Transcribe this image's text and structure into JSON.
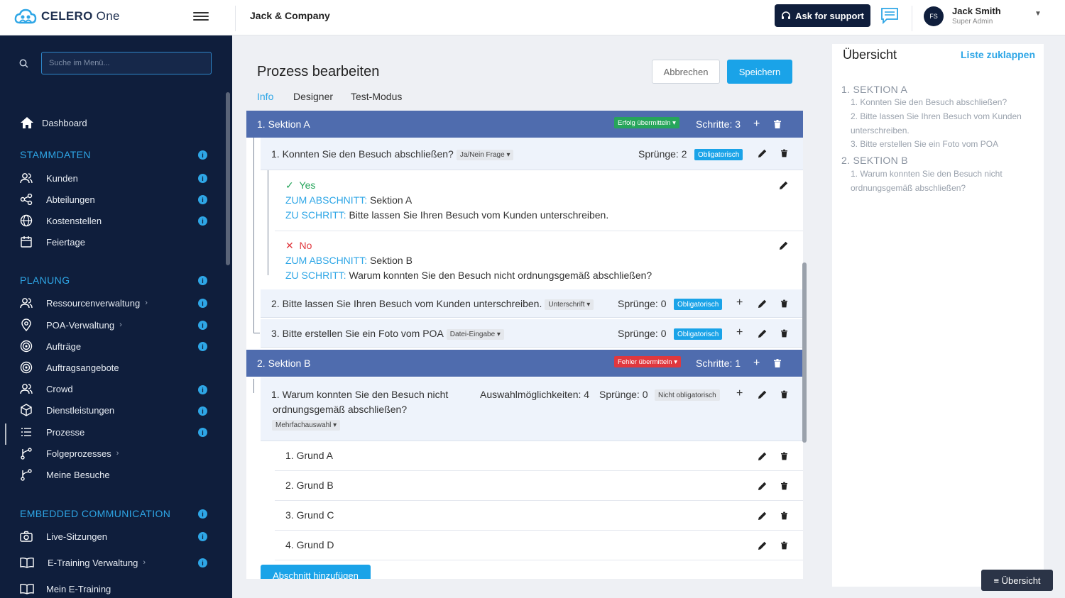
{
  "header": {
    "logo_strong": "CELERO",
    "logo_light": "One",
    "company": "Jack & Company",
    "support_label": "Ask for support",
    "user_initials": "FS",
    "user_name": "Jack Smith",
    "user_role": "Super Admin"
  },
  "sidebar": {
    "search_placeholder": "Suche im Menü...",
    "dashboard": "Dashboard",
    "sections": [
      {
        "title": "STAMMDATEN",
        "items": [
          "Kunden",
          "Abteilungen",
          "Kostenstellen",
          "Feiertage"
        ]
      },
      {
        "title": "PLANUNG",
        "items": [
          "Ressourcenverwaltung",
          "POA-Verwaltung",
          "Aufträge",
          "Auftragsangebote",
          "Crowd",
          "Dienstleistungen",
          "Prozesse",
          "Folgeprozesses",
          "Meine Besuche"
        ]
      },
      {
        "title": "EMBEDDED COMMUNICATION",
        "items": [
          "Live-Sitzungen",
          "E-Training Verwaltung",
          "Mein E-Training"
        ]
      }
    ],
    "active_item": "Prozesse"
  },
  "main": {
    "title": "Prozess bearbeiten",
    "cancel_label": "Abbrechen",
    "save_label": "Speichern",
    "tabs": [
      "Info",
      "Designer",
      "Test-Modus"
    ],
    "active_tab": "Info",
    "add_section_label": "Abschnitt hinzufügen",
    "sections": [
      {
        "title": "1. Sektion A",
        "badge": "Erfolg übermitteln",
        "steps": "Schritte: 3",
        "questions": [
          {
            "text": "1. Konnten Sie den Besuch abschließen?",
            "type": "Ja/Nein Frage",
            "jumps": "Sprünge: 2",
            "required": "Obligatorisch",
            "answers": [
              {
                "label": "Yes",
                "section_key": "ZUM ABSCHNITT:",
                "section_val": "Sektion A",
                "step_key": "ZU SCHRITT:",
                "step_val": "Bitte lassen Sie Ihren Besuch vom Kunden unterschreiben."
              },
              {
                "label": "No",
                "section_key": "ZUM ABSCHNITT:",
                "section_val": "Sektion B",
                "step_key": "ZU SCHRITT:",
                "step_val": "Warum konnten Sie den Besuch nicht  ordnungsgemäß abschließen?"
              }
            ]
          },
          {
            "text": "2. Bitte lassen Sie Ihren Besuch vom Kunden unterschreiben.",
            "type": "Unterschrift",
            "jumps": "Sprünge: 0",
            "required": "Obligatorisch"
          },
          {
            "text": "3. Bitte erstellen Sie ein Foto vom POA",
            "type": "Datei-Eingabe",
            "jumps": "Sprünge: 0",
            "required": "Obligatorisch"
          }
        ]
      },
      {
        "title": "2. Sektion B",
        "badge": "Fehler übermitteln",
        "steps": "Schritte: 1",
        "questions": [
          {
            "text_line1": "1. Warum konnten Sie den Besuch nicht",
            "text_line2": "ordnungsgemäß abschließen?",
            "type": "Mehrfachauswahl",
            "options_count": "Auswahlmöglichkeiten: 4",
            "jumps": "Sprünge: 0",
            "required": "Nicht obligatorisch",
            "options": [
              "1. Grund A",
              "2. Grund B",
              "3. Grund C",
              "4. Grund D"
            ]
          }
        ]
      }
    ]
  },
  "overview": {
    "title": "Übersicht",
    "collapse_label": "Liste zuklappen",
    "sections": [
      {
        "title": "1. SEKTION A",
        "items": [
          "1. Konnten Sie den Besuch abschließen?",
          "2. Bitte lassen Sie Ihren Besuch vom Kunden unterschreiben.",
          "3. Bitte erstellen Sie ein Foto vom POA"
        ]
      },
      {
        "title": "2. SEKTION B",
        "items": [
          "1. Warum konnten Sie den Besuch nicht ordnungsgemäß abschließen?"
        ]
      }
    ],
    "button_label": "≡ Übersicht"
  },
  "colors": {
    "sidebar_bg": "#0f1e3c",
    "accent": "#1aa3e8",
    "section_head": "#4f6cae",
    "success": "#26a55b",
    "error": "#e0383e"
  }
}
